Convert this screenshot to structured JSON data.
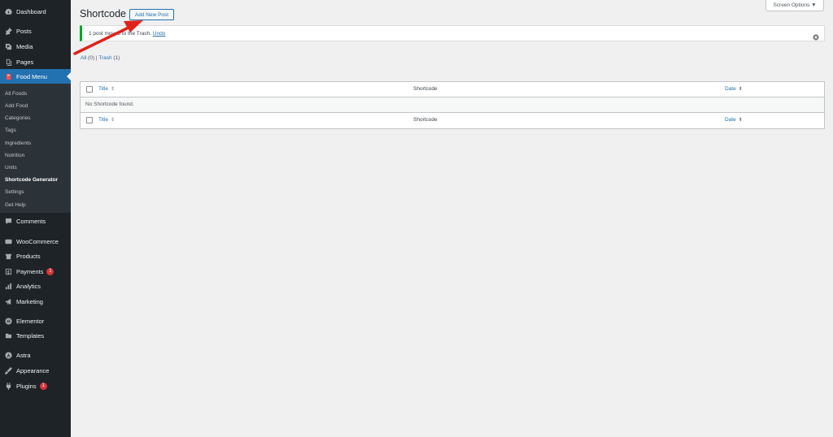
{
  "sidebar": {
    "items": [
      {
        "label": "Dashboard",
        "icon": "dashboard-icon"
      },
      {
        "label": "Posts",
        "icon": "pin-icon"
      },
      {
        "label": "Media",
        "icon": "media-icon"
      },
      {
        "label": "Pages",
        "icon": "pages-icon"
      },
      {
        "label": "Food Menu",
        "icon": "food-menu-icon"
      },
      {
        "label": "Comments",
        "icon": "comment-icon"
      },
      {
        "label": "WooCommerce",
        "icon": "woocommerce-icon"
      },
      {
        "label": "Products",
        "icon": "products-icon"
      },
      {
        "label": "Payments",
        "icon": "payments-icon",
        "badge": "1"
      },
      {
        "label": "Analytics",
        "icon": "analytics-icon"
      },
      {
        "label": "Marketing",
        "icon": "megaphone-icon"
      },
      {
        "label": "Elementor",
        "icon": "elementor-icon"
      },
      {
        "label": "Templates",
        "icon": "folder-icon"
      },
      {
        "label": "Astra",
        "icon": "astra-icon"
      },
      {
        "label": "Appearance",
        "icon": "brush-icon"
      },
      {
        "label": "Plugins",
        "icon": "plugin-icon",
        "badge": "1"
      }
    ],
    "submenu": [
      "All Foods",
      "Add Food",
      "Categories",
      "Tags",
      "Ingredients",
      "Nutrition",
      "Units",
      "Shortcode Generator",
      "Settings",
      "Get Help"
    ]
  },
  "header": {
    "screen_options": "Screen Options ▼",
    "title": "Shortcode",
    "add_new": "Add New Post"
  },
  "notice": {
    "text": "1 post moved to the Trash.",
    "undo": "Undo"
  },
  "filters": {
    "all": "All",
    "all_count": "(0)",
    "separator": "|",
    "trash": "Trash",
    "trash_count": "(1)"
  },
  "table": {
    "columns": {
      "title": "Title",
      "shortcode": "Shortcode",
      "date": "Date"
    },
    "empty": "No Shortcode found."
  },
  "colors": {
    "sidebar_bg": "#1d2327",
    "accent": "#2271b1",
    "notice_success": "#00a32a",
    "badge": "#d63638",
    "annotation_arrow": "#e0221a"
  }
}
